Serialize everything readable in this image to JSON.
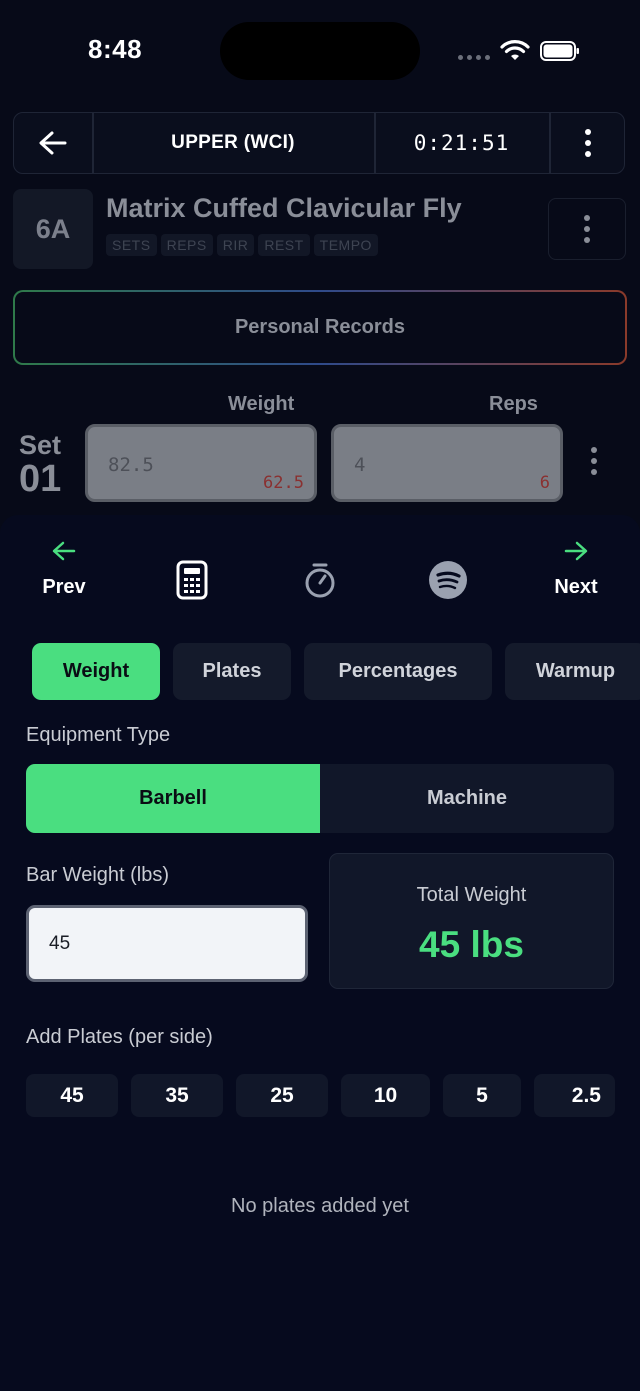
{
  "status": {
    "time": "8:48"
  },
  "header": {
    "title": "UPPER (WCI)",
    "timer": "0:21:51"
  },
  "exercise": {
    "badge": "6A",
    "name": "Matrix Cuffed Clavicular Fly",
    "tags": [
      "SETS",
      "REPS",
      "RIR",
      "REST",
      "TEMPO"
    ]
  },
  "personal_records_label": "Personal Records",
  "set_entry": {
    "weight_label": "Weight",
    "reps_label": "Reps",
    "set_word": "Set",
    "set_number": "01",
    "weight_value": "82.5",
    "weight_previous": "62.5",
    "reps_value": "4",
    "reps_previous": "6"
  },
  "nav": {
    "prev": "Prev",
    "next": "Next"
  },
  "tabs": [
    "Weight",
    "Plates",
    "Percentages",
    "Warmup"
  ],
  "calculator": {
    "equipment_label": "Equipment Type",
    "equipment_options": [
      "Barbell",
      "Machine"
    ],
    "bar_weight_label": "Bar Weight (lbs)",
    "bar_weight_value": "45",
    "total_label": "Total Weight",
    "total_value": "45 lbs",
    "add_plates_label": "Add Plates (per side)",
    "plates": [
      "45",
      "35",
      "25",
      "10",
      "5",
      "2.5"
    ],
    "empty_message": "No plates added yet"
  },
  "colors": {
    "accent": "#4ade80",
    "background": "#070a18",
    "card": "#111729"
  }
}
